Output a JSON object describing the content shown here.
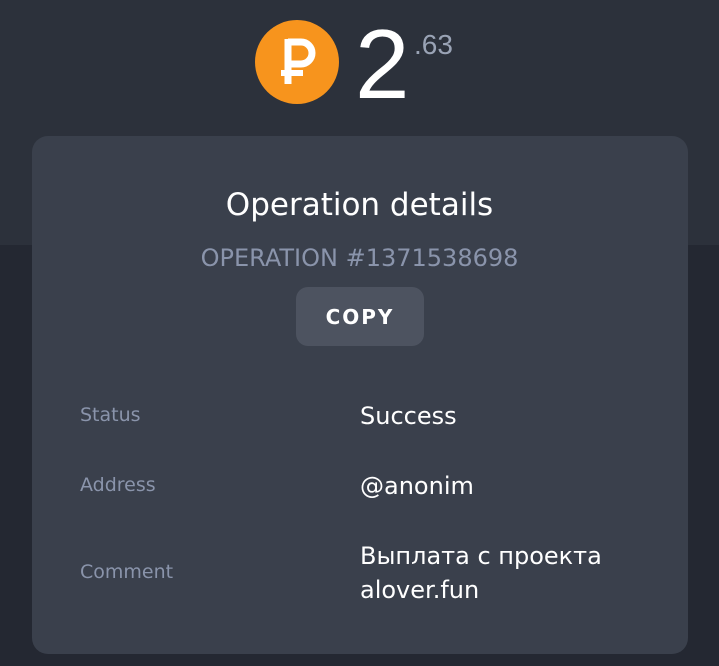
{
  "balance": {
    "currency_icon": "ruble-icon",
    "coin_color": "#f7941d",
    "integer": "2",
    "fraction": ".63"
  },
  "details": {
    "title": "Operation details",
    "operation_id": "OPERATION #1371538698",
    "copy_label": "COPY",
    "rows": [
      {
        "label": "Status",
        "value": "Success"
      },
      {
        "label": "Address",
        "value": "@anonim"
      },
      {
        "label": "Comment",
        "value_line1": "Выплата с проекта",
        "value_line2": "alover.fun"
      }
    ]
  },
  "colors": {
    "background": "#242832",
    "top_band": "#2c313b",
    "card": "#3a404c",
    "button": "#4d5360",
    "muted_text": "#8a94ab"
  }
}
